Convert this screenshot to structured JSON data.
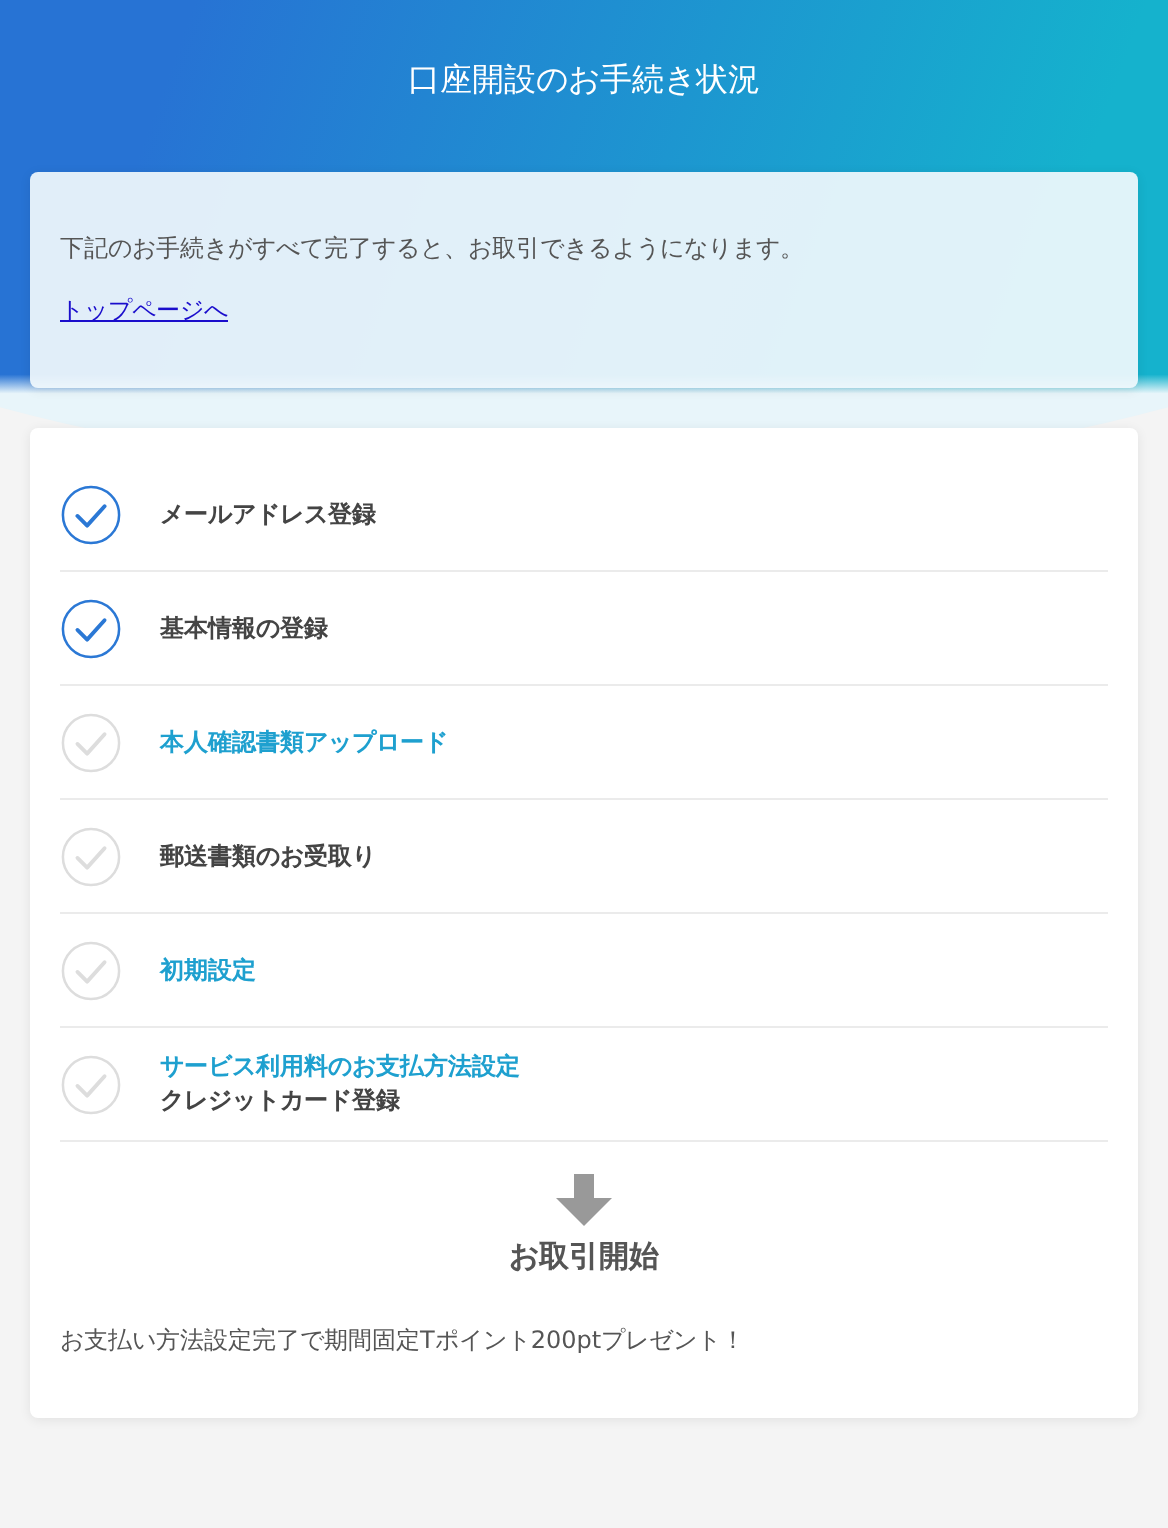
{
  "header": {
    "title": "口座開設のお手続き状況"
  },
  "intro": {
    "message": "下記のお手続きがすべて完了すると、お取引できるようになります。",
    "link": "トップページへ"
  },
  "steps": [
    {
      "label": "メールアドレス登録",
      "checked": true,
      "kind": "text"
    },
    {
      "label": "基本情報の登録",
      "checked": true,
      "kind": "text"
    },
    {
      "label": "本人確認書類アップロード",
      "checked": false,
      "kind": "link"
    },
    {
      "label": "郵送書類のお受取り",
      "checked": false,
      "kind": "text"
    },
    {
      "label": "初期設定",
      "checked": false,
      "kind": "link"
    },
    {
      "label": "サービス利用料のお支払方法設定",
      "sublabel": "クレジットカード登録",
      "checked": false,
      "kind": "link"
    }
  ],
  "goal": {
    "title": "お取引開始",
    "note": "お支払い方法設定完了で期間固定Tポイント200ptプレゼント！"
  }
}
